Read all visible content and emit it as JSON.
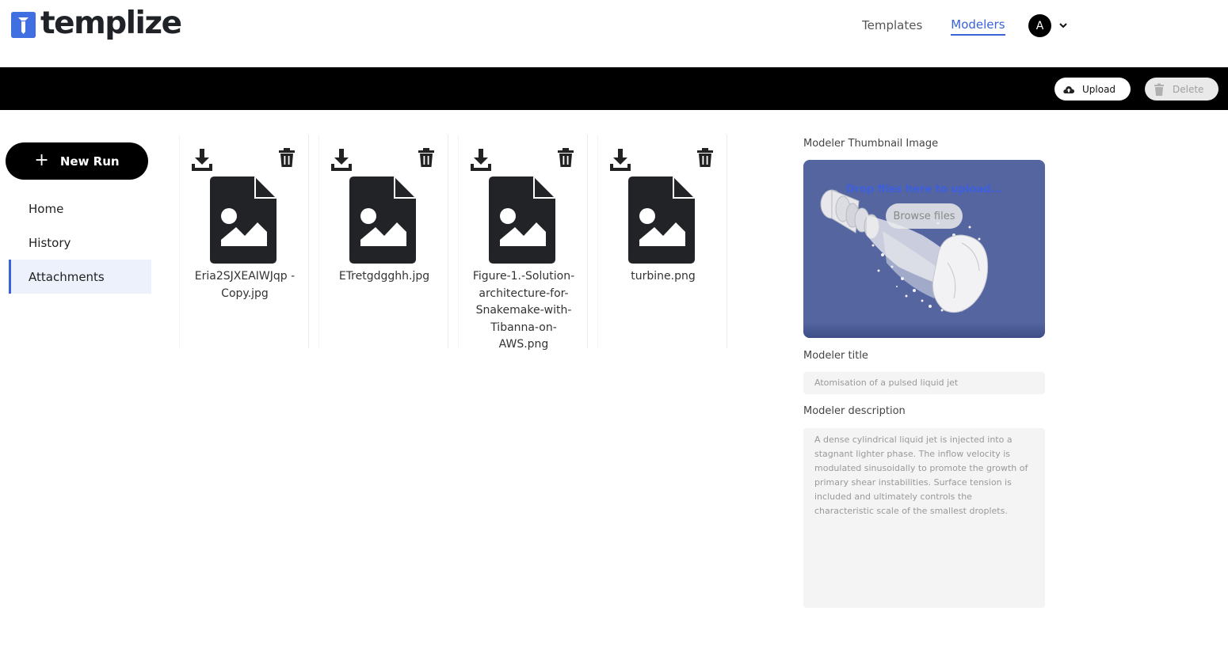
{
  "app": {
    "name": "templize"
  },
  "nav": {
    "templates": "Templates",
    "modelers": "Modelers",
    "avatar_initial": "A"
  },
  "toolbar": {
    "upload": "Upload",
    "delete": "Delete"
  },
  "sidebar": {
    "new_run": "New Run",
    "items": [
      {
        "label": "Home",
        "active": false
      },
      {
        "label": "History",
        "active": false
      },
      {
        "label": "Attachments",
        "active": true
      }
    ]
  },
  "files": [
    {
      "name": "Eria2SJXEAIWJqp - Copy.jpg"
    },
    {
      "name": "ETretgdgghh.jpg"
    },
    {
      "name": "Figure-1.-Solution-architecture-for-Snakemake-with-Tibanna-on-AWS.png"
    },
    {
      "name": "turbine.png"
    }
  ],
  "panel": {
    "thumb_label": "Modeler Thumbnail Image",
    "drop_text": "Drop files here to upload...",
    "browse": "Browse files",
    "title_label": "Modeler title",
    "title_value": "Atomisation of a pulsed liquid jet",
    "desc_label": "Modeler description",
    "desc_value": "A dense cylindrical liquid jet is injected into a stagnant lighter phase. The inflow velocity is modulated sinusoidally to promote the growth of primary shear instabilities. Surface tension is included and ultimately controls the characteristic scale of the smallest droplets."
  },
  "colors": {
    "accent": "#3a63d8",
    "thumb_bg": "#5465a0",
    "toolbar": "#000000"
  }
}
